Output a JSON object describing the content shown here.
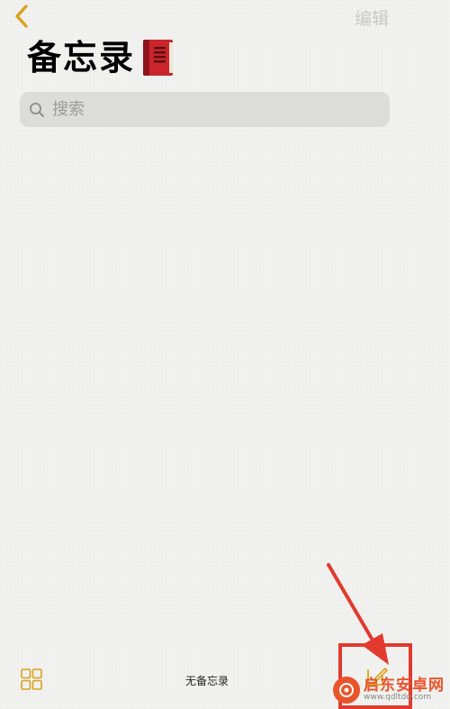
{
  "nav": {
    "edit_label": "编辑"
  },
  "header": {
    "title": "备忘录"
  },
  "search": {
    "placeholder": "搜索"
  },
  "bottom_bar": {
    "status_text": "无备忘录"
  },
  "annotation": {
    "color": "#e23a2e"
  },
  "watermark": {
    "name": "启东安卓网",
    "url": "www.qdltdq.com"
  },
  "colors": {
    "accent": "#d9a21b",
    "background": "#f2f2f0"
  }
}
